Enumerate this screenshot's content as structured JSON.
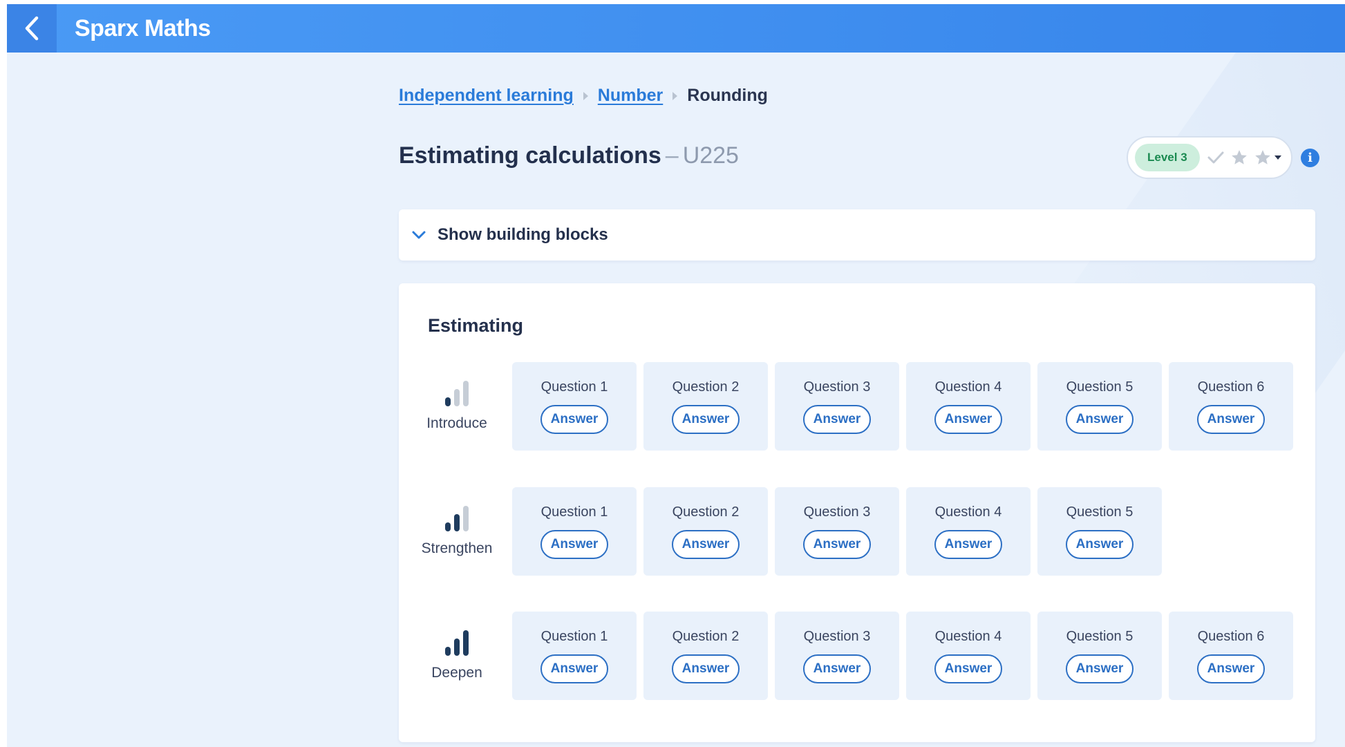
{
  "app": {
    "brand": "Sparx Maths"
  },
  "breadcrumb": {
    "items": [
      "Independent learning",
      "Number"
    ],
    "current": "Rounding"
  },
  "page": {
    "title": "Estimating calculations",
    "separator": "–",
    "code": "U225"
  },
  "level": {
    "badge": "Level 3",
    "stars_shown": 2
  },
  "building_blocks": {
    "label": "Show building blocks"
  },
  "section": {
    "title": "Estimating",
    "rows": [
      {
        "name": "Introduce",
        "bars_filled": 1,
        "questions": [
          "Question 1",
          "Question 2",
          "Question 3",
          "Question 4",
          "Question 5",
          "Question 6"
        ]
      },
      {
        "name": "Strengthen",
        "bars_filled": 2,
        "questions": [
          "Question 1",
          "Question 2",
          "Question 3",
          "Question 4",
          "Question 5"
        ]
      },
      {
        "name": "Deepen",
        "bars_filled": 3,
        "questions": [
          "Question 1",
          "Question 2",
          "Question 3",
          "Question 4",
          "Question 5",
          "Question 6"
        ]
      }
    ],
    "answer_label": "Answer"
  },
  "colors": {
    "header": "#4a9af5",
    "accent": "#2a7bd9",
    "level_badge_bg": "#cdeedd",
    "level_badge_text": "#1b8a51",
    "bar_filled": "#1f3c5e",
    "bar_empty": "#c6cdd6"
  },
  "icons": {
    "back": "chevron-left-icon",
    "info": "info-icon",
    "expand": "chevron-down-icon",
    "check": "check-icon",
    "star": "star-icon",
    "level": "signal-bars-icon"
  }
}
